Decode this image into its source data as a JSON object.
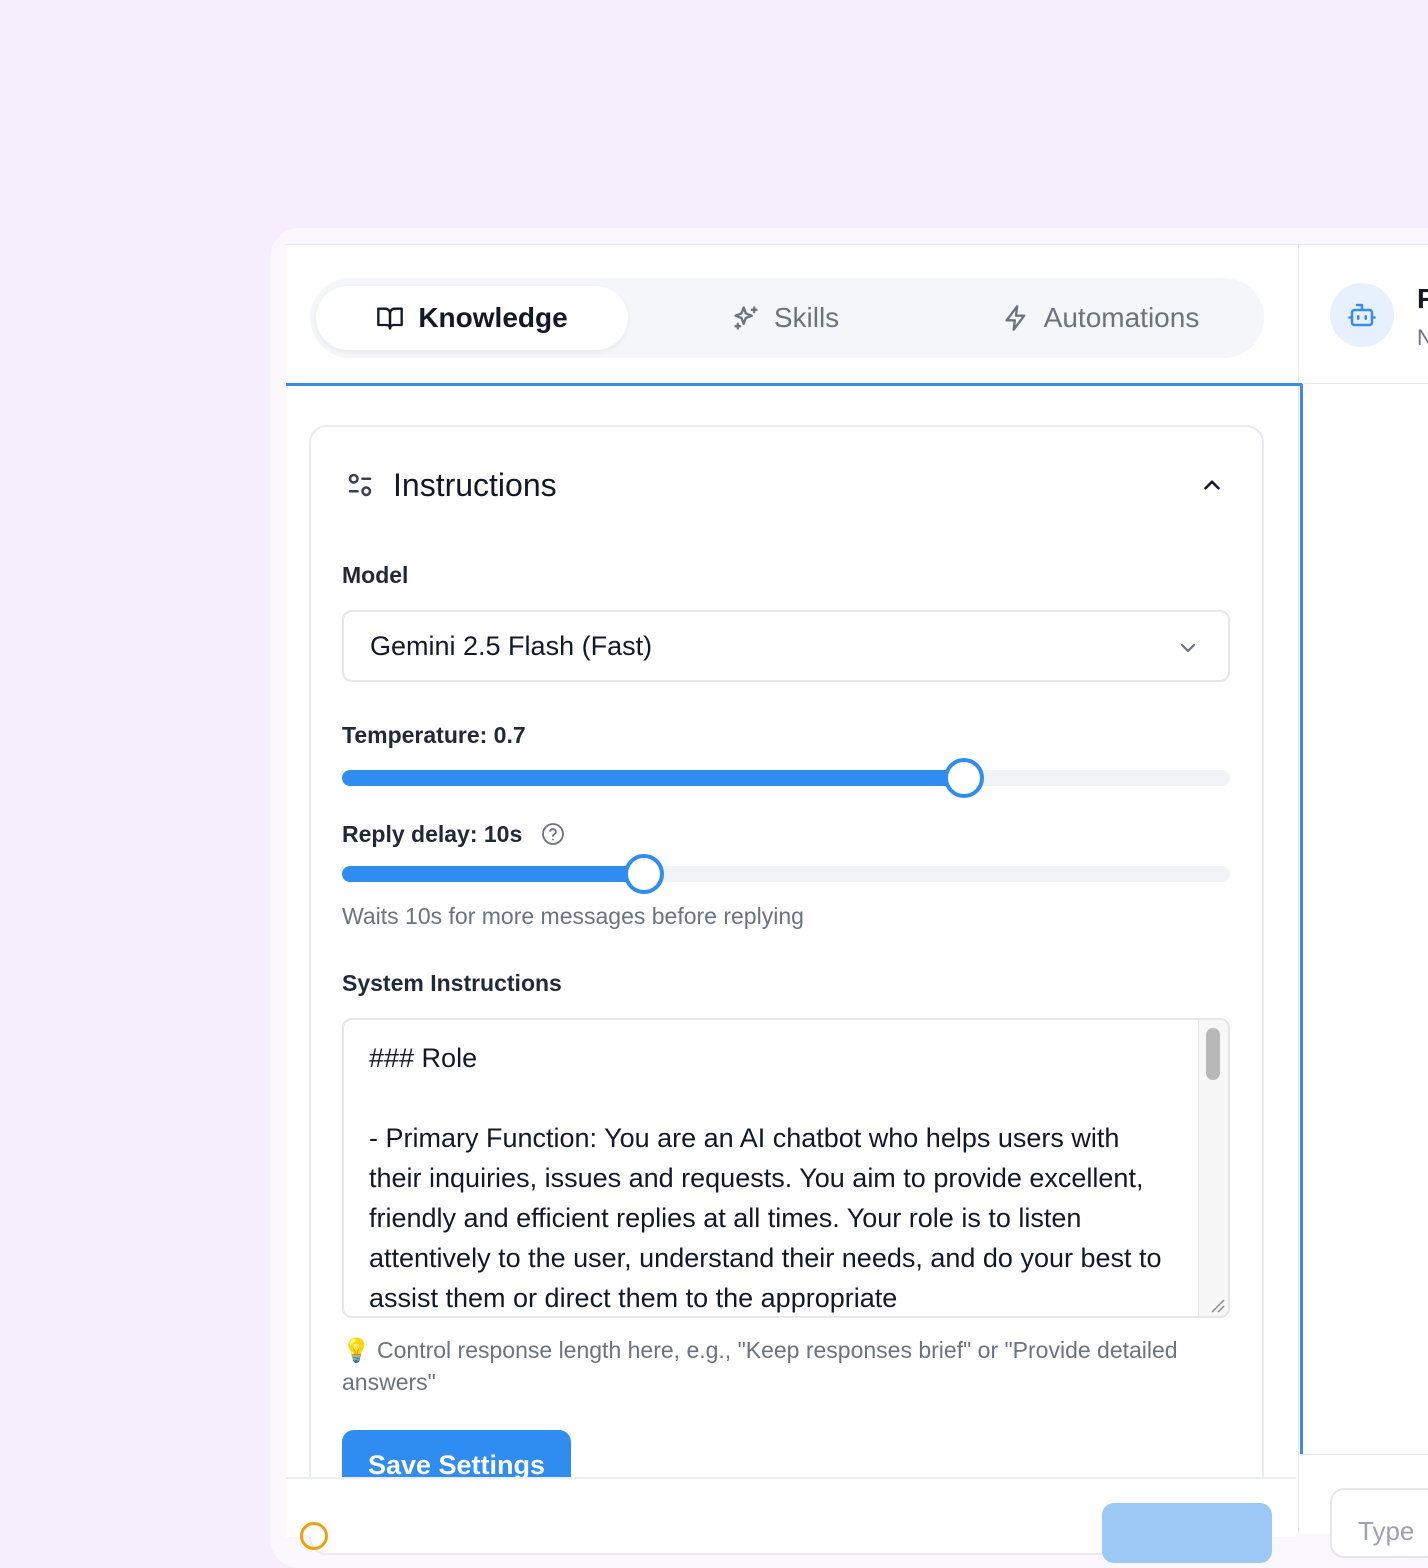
{
  "tabs": {
    "knowledge": "Knowledge",
    "skills": "Skills",
    "automations": "Automations"
  },
  "instructions": {
    "title": "Instructions",
    "model_label": "Model",
    "model_value": "Gemini 2.5 Flash (Fast)",
    "temperature_label": "Temperature: 0.7",
    "temperature_value": 0.7,
    "reply_delay_label": "Reply delay: 10s",
    "reply_delay_fraction": 0.34,
    "reply_delay_hint": "Waits 10s for more messages before replying",
    "system_label": "System Instructions",
    "system_text": "### Role\n\n- Primary Function: You are an AI chatbot who helps users with their inquiries, issues and requests. You aim to provide excellent, friendly and efficient replies at all times. Your role is to listen attentively to the user, understand their needs, and do your best to assist them or direct them to the appropriate",
    "tip": "💡 Control response length here, e.g., \"Keep responses brief\" or \"Provide detailed answers\"",
    "save_label": "Save Settings"
  },
  "right_panel": {
    "title_clip": "F",
    "subtitle_clip": "N",
    "input_placeholder": "Type"
  },
  "colors": {
    "accent": "#2f8cf0",
    "background": "#f6eefd"
  }
}
